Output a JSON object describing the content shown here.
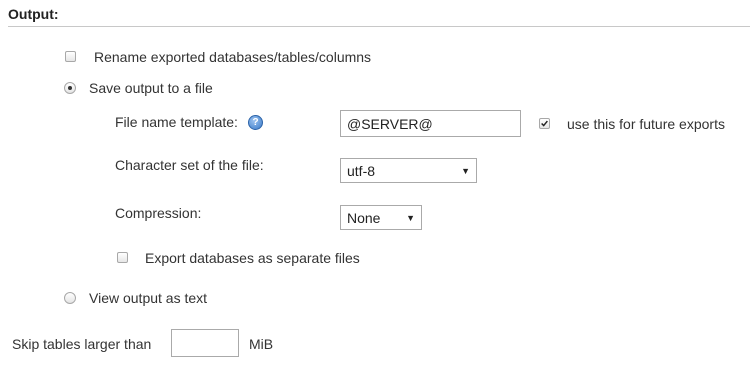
{
  "section": {
    "title": "Output:"
  },
  "rename_option": {
    "label": "Rename exported databases/tables/columns",
    "checked": false
  },
  "save_to_file": {
    "label": "Save output to a file",
    "selected": true
  },
  "file_name_template": {
    "label": "File name template:",
    "help_icon": "help-icon",
    "value": "@SERVER@",
    "future_label": "use this for future exports",
    "future_checked": true
  },
  "charset": {
    "label": "Character set of the file:",
    "selected": "utf-8"
  },
  "compression": {
    "label": "Compression:",
    "selected": "None"
  },
  "separate_files": {
    "label": "Export databases as separate files",
    "checked": false
  },
  "view_as_text": {
    "label": "View output as text",
    "selected": false
  },
  "skip_tables": {
    "label": "Skip tables larger than",
    "value": "",
    "unit": "MiB"
  }
}
